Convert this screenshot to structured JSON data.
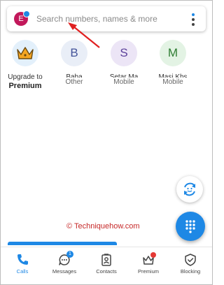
{
  "search": {
    "avatar_initial": "E",
    "placeholder": "Search numbers, names & more"
  },
  "favorites": [
    {
      "initial": "",
      "name": "Upgrade to",
      "sub": "Premium",
      "icon": "crown-icon"
    },
    {
      "initial": "B",
      "name": "Baba",
      "sub": "Other"
    },
    {
      "initial": "S",
      "name": "Setar Ma",
      "sub": "Mobile"
    },
    {
      "initial": "M",
      "name": "Masi Khs",
      "sub": "Mobile"
    }
  ],
  "watermark": "© Techniquehow.com",
  "nav": {
    "items": [
      {
        "label": "Calls",
        "icon": "phone-icon"
      },
      {
        "label": "Messages",
        "icon": "message-icon",
        "badge": "1"
      },
      {
        "label": "Contacts",
        "icon": "contacts-icon"
      },
      {
        "label": "Premium",
        "icon": "crown-icon"
      },
      {
        "label": "Blocking",
        "icon": "shield-check-icon"
      }
    ]
  },
  "colors": {
    "accent": "#1e88e5",
    "avatar": "#c2185b",
    "arrow": "#e02020",
    "watermark": "#c62828"
  }
}
